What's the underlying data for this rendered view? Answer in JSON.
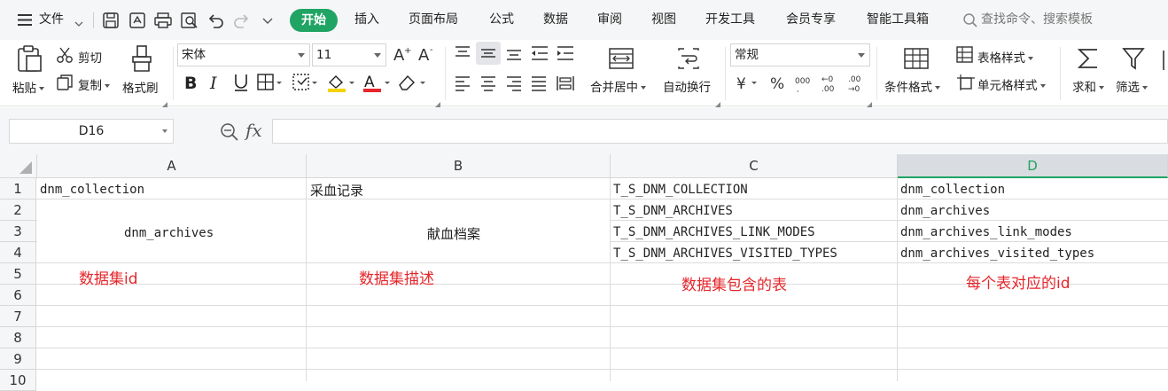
{
  "menubar": {
    "file_label": "文件",
    "tabs": [
      "开始",
      "插入",
      "页面布局",
      "公式",
      "数据",
      "审阅",
      "视图",
      "开发工具",
      "会员专享",
      "智能工具箱"
    ],
    "search_placeholder": "查找命令、搜索模板"
  },
  "ribbon": {
    "paste": "粘贴",
    "cut": "剪切",
    "copy": "复制",
    "format_painter": "格式刷",
    "font_name": "宋体",
    "font_size": "11",
    "merge_center": "合并居中",
    "wrap_text": "自动换行",
    "number_format": "常规",
    "conditional_format": "条件格式",
    "table_style": "表格样式",
    "cell_style": "单元格样式",
    "sum": "求和",
    "filter": "筛选"
  },
  "formulabar": {
    "name_box": "D16",
    "fx": "fx",
    "content": ""
  },
  "grid": {
    "columns": [
      "A",
      "B",
      "C",
      "D"
    ],
    "selected_column": "D",
    "rows": [
      "1",
      "2",
      "3",
      "4",
      "5",
      "6",
      "7",
      "8",
      "9",
      "10"
    ],
    "cells": {
      "A1": "dnm_collection",
      "B1": "采血记录",
      "C1": "T_S_DNM_COLLECTION",
      "D1": "dnm_collection",
      "A2_4": "dnm_archives",
      "B2_4": "献血档案",
      "C2": "T_S_DNM_ARCHIVES",
      "D2": "dnm_archives",
      "C3": "T_S_DNM_ARCHIVES_LINK_MODES",
      "D3": "dnm_archives_link_modes",
      "C4": "T_S_DNM_ARCHIVES_VISITED_TYPES",
      "D4": "dnm_archives_visited_types"
    },
    "annotations": {
      "a": "数据集id",
      "b": "数据集描述",
      "c": "数据集包含的表",
      "d": "每个表对应的id"
    }
  },
  "colors": {
    "accent": "#1fa463",
    "annotation": "#e5262b"
  }
}
